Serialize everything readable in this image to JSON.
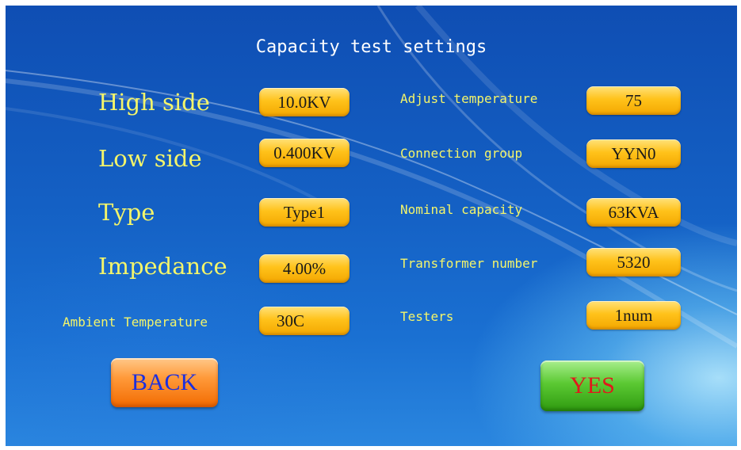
{
  "screen": {
    "title": "Capacity test settings"
  },
  "left_fields": [
    {
      "label": "High side",
      "value": "10.0KV"
    },
    {
      "label": "Low side",
      "value": "0.400KV"
    },
    {
      "label": "Type",
      "value": "Type1"
    },
    {
      "label": "Impedance",
      "value": "4.00%"
    },
    {
      "label": "Ambient Temperature",
      "value": "30C"
    }
  ],
  "right_fields": [
    {
      "label": "Adjust temperature",
      "value": "75"
    },
    {
      "label": "Connection group",
      "value": "YYN0"
    },
    {
      "label": "Nominal capacity",
      "value": "63KVA"
    },
    {
      "label": "Transformer number",
      "value": "5320"
    },
    {
      "label": "Testers",
      "value": "1num"
    }
  ],
  "buttons": {
    "back_label": "BACK",
    "yes_label": "YES"
  },
  "colors": {
    "label": "#f4f56a",
    "value_field": "#ffc21a",
    "back_button": "#ff9a3a",
    "back_text": "#1b2fe0",
    "yes_button": "#5bc933",
    "yes_text": "#e0191c"
  }
}
